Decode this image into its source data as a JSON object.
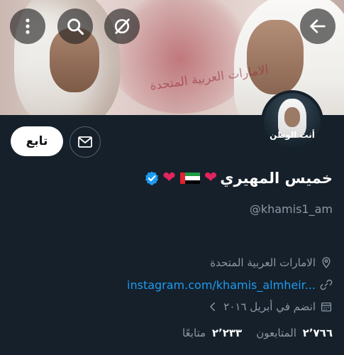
{
  "header": {
    "back_icon": "arrow-right-icon",
    "more_icon": "vertical-dots-icon",
    "search_icon": "search-icon",
    "noguess_icon": "slashed-circle-icon",
    "banner_text": "الامارات العربية المتحدة"
  },
  "avatar": {
    "caption": "أنت الوطن"
  },
  "actions": {
    "follow_label": "تابع",
    "mail_icon": "envelope-icon"
  },
  "profile": {
    "display_name": "خميس المهيري",
    "handle": "@khamis1_am",
    "location": "الامارات العربية المتحدة",
    "link": "instagram.com/khamis_almheir...",
    "joined": "انضم في أبريل ٢٠١٦",
    "verified_color": "#1d9bf0"
  },
  "stats": {
    "following_count": "٢٬٢٣٣",
    "following_label": "متابعًا",
    "followers_count": "٢٬٧٦٦",
    "followers_label": "المتابعون"
  }
}
